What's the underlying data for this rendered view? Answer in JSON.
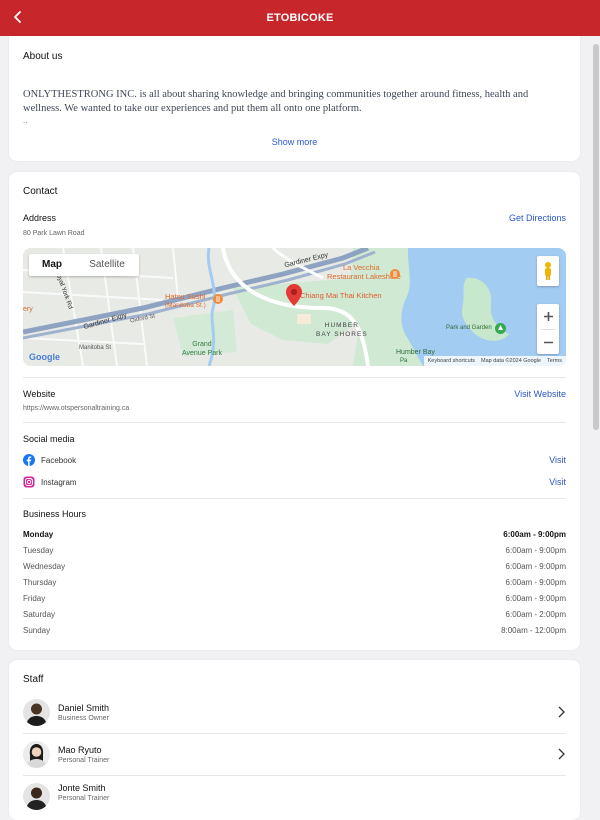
{
  "header": {
    "title": "ETOBICOKE"
  },
  "about": {
    "title": "About us",
    "text": "ONLYTHESTRONG INC. is all about sharing knowledge and bringing communities together around fitness, health and wellness. We wanted to take our experiences and put them all onto one platform.",
    "ellipsis": "..",
    "show_more": "Show more"
  },
  "contact": {
    "title": "Contact",
    "address_label": "Address",
    "address": "80 Park Lawn Road",
    "directions": "Get Directions",
    "map": {
      "tab_map": "Map",
      "tab_satellite": "Satellite",
      "labels": {
        "gardiner1": "Gardiner Expy",
        "gardiner2": "Gardiner Expy",
        "royal_york": "Royal York Rd",
        "oxford": "Oxford St",
        "manitoba": "Manitoba St",
        "la_vecchia": "La Vecchia",
        "la_vecchia2": "Restaurant Lakeshore",
        "hatsu": "Hatsu Sushi",
        "hatsu2": "(Manitoba St.)",
        "chiang_mai": "Chiang Mai Thai Kitchen",
        "humber1": "HUMBER",
        "humber2": "BAY SHORES",
        "grand1": "Grand",
        "grand2": "Avenue Park",
        "park_garden": "Park and Garden",
        "humber_bay": "Humber Bay",
        "park_short": "Pa",
        "partial_ery": "ery",
        "google": "Google",
        "shortcuts": "Keyboard shortcuts",
        "map_data": "Map data ©2024 Google",
        "terms": "Terms"
      }
    },
    "website_label": "Website",
    "website_url": "https://www.otspersonaltraining.ca",
    "visit_website": "Visit Website",
    "social_label": "Social media",
    "social": [
      {
        "name": "Facebook",
        "action": "Visit",
        "icon": "facebook-icon"
      },
      {
        "name": "Instagram",
        "action": "Visit",
        "icon": "instagram-icon"
      }
    ],
    "hours_label": "Business Hours",
    "hours": [
      {
        "day": "Monday",
        "time": "6:00am - 9:00pm"
      },
      {
        "day": "Tuesday",
        "time": "6:00am - 9:00pm"
      },
      {
        "day": "Wednesday",
        "time": "6:00am - 9:00pm"
      },
      {
        "day": "Thursday",
        "time": "6:00am - 9:00pm"
      },
      {
        "day": "Friday",
        "time": "6:00am - 9:00pm"
      },
      {
        "day": "Saturday",
        "time": "6:00am - 2:00pm"
      },
      {
        "day": "Sunday",
        "time": "8:00am - 12:00pm"
      }
    ]
  },
  "staff": {
    "title": "Staff",
    "members": [
      {
        "name": "Daniel Smith",
        "role": "Business Owner"
      },
      {
        "name": "Mao Ryuto",
        "role": "Personal Trainer"
      },
      {
        "name": "Jonte Smith",
        "role": "Personal Trainer"
      }
    ]
  },
  "colors": {
    "brand": "#c7262b",
    "link": "#2a57c8",
    "water": "#a3ccf2",
    "park": "#c7e8cc"
  }
}
